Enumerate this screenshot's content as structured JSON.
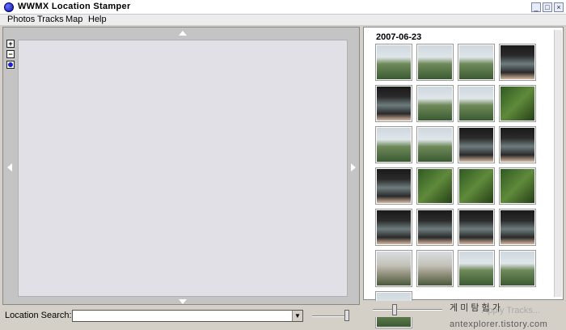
{
  "window": {
    "title": "WWMX Location Stamper",
    "min_label": "_",
    "max_label": "□",
    "close_label": "×"
  },
  "menu": [
    "Photos",
    "Tracks",
    "Map",
    "Help"
  ],
  "map": {
    "zoom_in": "+",
    "zoom_out": "−"
  },
  "photos": {
    "date": "2007-06-23"
  },
  "apply_button": "Apply Tracks...",
  "overlay_text": "게 미 탐 험 가",
  "footer": {
    "search_label": "Location Search:",
    "search_value": "",
    "watermark": "antexplorer.tistory.com"
  },
  "colors": {
    "map_bg": "#e1e0e6",
    "panel_bg": "#c4c4c4",
    "window_bg": "#d4d0c8",
    "title_icon": "#1a24c8"
  },
  "thumbnails": [
    "mountain-landscape",
    "mountain-landscape",
    "mountain-landscape",
    "gps-device",
    "gps-device",
    "mountain-landscape",
    "mountain-landscape",
    "forest",
    "mountain-landscape",
    "mountain-landscape",
    "gps-device",
    "gps-device",
    "gps-device",
    "forest",
    "forest",
    "forest",
    "gps-device",
    "gps-device",
    "gps-device",
    "gps-device",
    "rock-landscape",
    "rock-landscape",
    "mountain-landscape",
    "mountain-landscape",
    "mountain-landscape"
  ]
}
